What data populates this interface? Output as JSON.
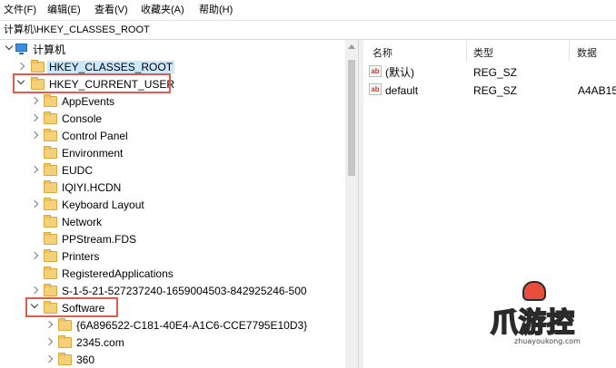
{
  "menubar": {
    "items": [
      "文件(F)",
      "编辑(E)",
      "查看(V)",
      "收藏夹(A)",
      "帮助(H)"
    ]
  },
  "address": {
    "path": "计算机\\HKEY_CLASSES_ROOT"
  },
  "tree": {
    "root": "计算机",
    "hkcr": "HKEY_CLASSES_ROOT",
    "hkcu": "HKEY_CURRENT_USER",
    "hkcu_children": [
      "AppEvents",
      "Console",
      "Control Panel",
      "Environment",
      "EUDC",
      "IQIYI.HCDN",
      "Keyboard Layout",
      "Network",
      "PPStream.FDS",
      "Printers",
      "RegisteredApplications",
      "S-1-5-21-527237240-1659004503-842925246-500",
      "Software"
    ],
    "software_children": [
      "{6A896522-C181-40E4-A1C6-CCE7795E10D3}",
      "2345.com",
      "360"
    ]
  },
  "list": {
    "columns": {
      "name": "名称",
      "type": "类型",
      "data": "数据"
    },
    "rows": [
      {
        "icon": "ab",
        "name": "(默认)",
        "type": "REG_SZ",
        "data": ""
      },
      {
        "icon": "ab",
        "name": "default",
        "type": "REG_SZ",
        "data": "A4AB15"
      }
    ]
  },
  "watermark": {
    "text": "爪游控",
    "url": "zhuayoukong.com"
  },
  "colors": {
    "highlight": "#e05a4f",
    "folder": "#f5d07a",
    "selection": "#cce8ff"
  }
}
